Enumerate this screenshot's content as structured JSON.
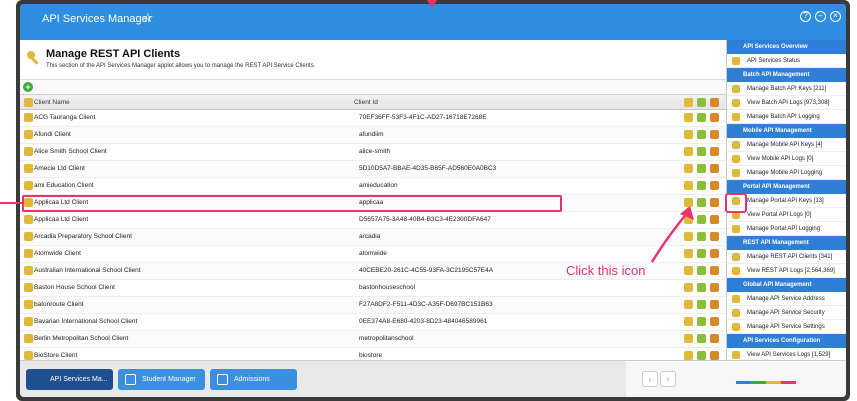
{
  "window": {
    "title": "API Services Manager",
    "star_icon": "star-icon",
    "controls": [
      "help-icon",
      "minimize-icon",
      "close-icon"
    ]
  },
  "header": {
    "title": "Manage REST API Clients",
    "description": "This section of the API Services Manager applet allows you to manage the REST API Service Clients."
  },
  "table": {
    "columns": {
      "name": "Client Name",
      "id": "Client Id"
    },
    "rows": [
      {
        "name": "ACG Tauranga Client",
        "id": "70EF36FF-53F3-4F1C-AD27-16718E7268E"
      },
      {
        "name": "Afundi Client",
        "id": "afundiim"
      },
      {
        "name": "Alice Smith School Client",
        "id": "alice-smith"
      },
      {
        "name": "Amecie Ltd Client",
        "id": "5D10D5A7-BBAE-4D35-B65F-AD560E0A0BC3"
      },
      {
        "name": "ami Education Client",
        "id": "amieducation"
      },
      {
        "name": "Applicaa Ltd Client",
        "id": "applicaa"
      },
      {
        "name": "Applicaa Ltd Client",
        "id": "D5657A75-3A48-40B4-B3C3-4E2300DFA647"
      },
      {
        "name": "Arcadia Preparatory School Client",
        "id": "arcadia"
      },
      {
        "name": "Atomwide Client",
        "id": "atomwide"
      },
      {
        "name": "Australian International School Client",
        "id": "40CEBE20-261C-4C55-93FA-3C2195C57E4A"
      },
      {
        "name": "Baston House School Client",
        "id": "bastonhouseschool"
      },
      {
        "name": "batonroute Client",
        "id": "F27A8DF2-F511-4D3C-A35F-D697BC151B63"
      },
      {
        "name": "Bavarian International School Client",
        "id": "0EE374A8-E680-4203-8D23-484046589961"
      },
      {
        "name": "Berlin Metropolitan School Client",
        "id": "metropolitanschool"
      },
      {
        "name": "BioStore Client",
        "id": "biostore"
      }
    ]
  },
  "sidebar": {
    "sections": [
      {
        "heading": "API Services Overview",
        "items": [
          "API Services Status"
        ]
      },
      {
        "heading": "Batch API Management",
        "items": [
          "Manage Batch API Keys [211]",
          "View Batch API Logs [973,308]",
          "Manage Batch API Logging"
        ]
      },
      {
        "heading": "Mobile API Management",
        "items": [
          "Manage Mobile API Keys [4]",
          "View Mobile API Logs [0]",
          "Manage Mobile API Logging"
        ]
      },
      {
        "heading": "Portal API Management",
        "items": [
          "Manage Portal API Keys [13]",
          "View Portal API Logs [0]",
          "Manage Portal API Logging"
        ]
      },
      {
        "heading": "REST API Management",
        "items": [
          "Manage REST API Clients [341]",
          "View REST API Logs [2,564,369]"
        ]
      },
      {
        "heading": "Global API Management",
        "items": [
          "Manage API Service Address",
          "Manage API Service Security",
          "Manage API Service Settings"
        ]
      },
      {
        "heading": "API Services Configuration",
        "items": [
          "View API Services Logs [1,529]"
        ]
      }
    ]
  },
  "taskbar": {
    "buttons": [
      "API Services Ma...",
      "Student Manager",
      "Admissions"
    ]
  },
  "annotation": {
    "text": "Click this icon"
  },
  "colors": {
    "titlebar": "#2f8ee0",
    "highlight": "#e8336d",
    "sidebar_heading": "#2f7fd6"
  }
}
